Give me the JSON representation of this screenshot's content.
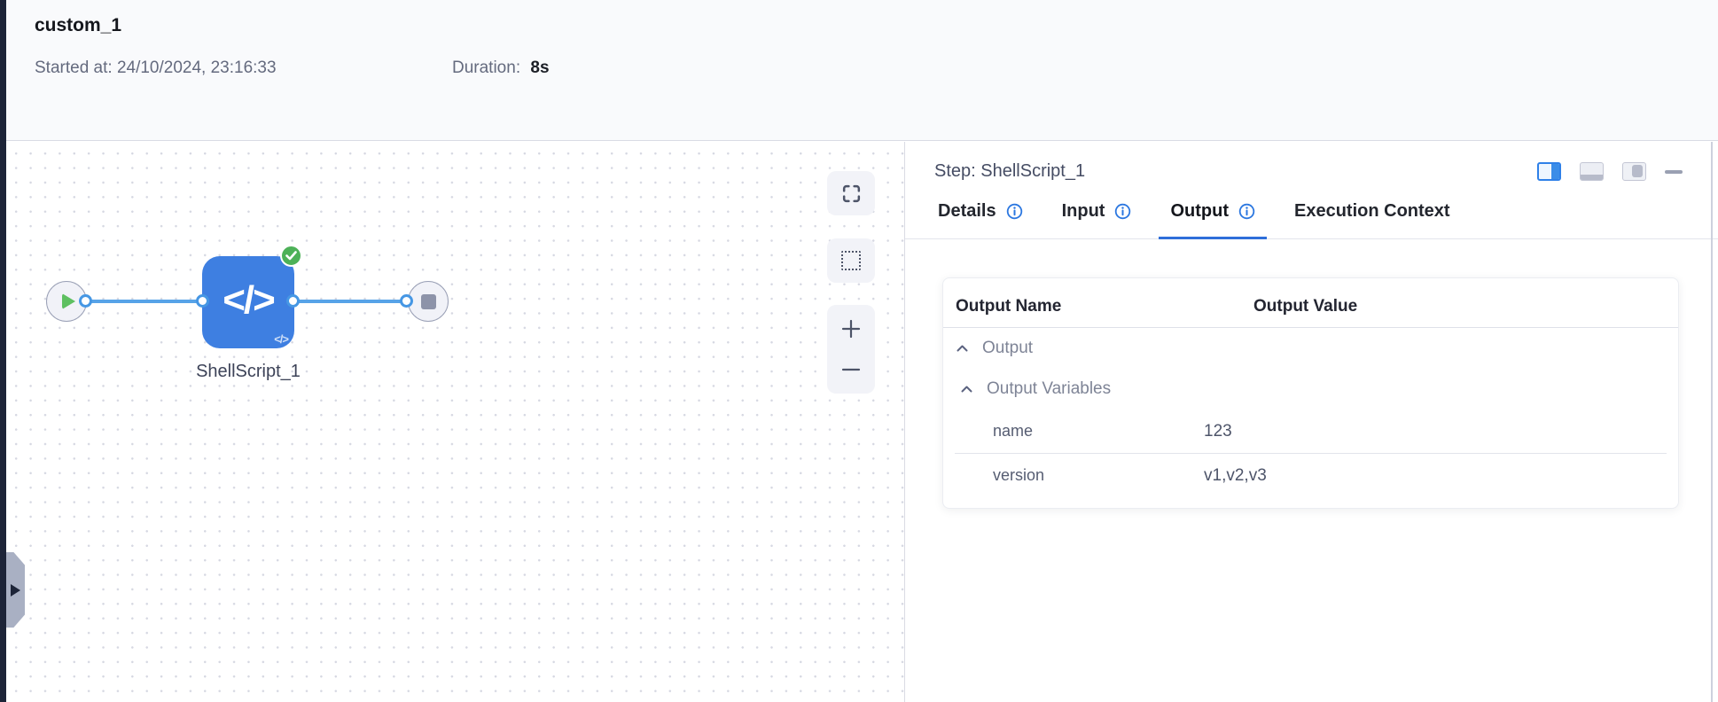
{
  "header": {
    "title": "custom_1",
    "started_label": "Started at:",
    "started_value": "24/10/2024, 23:16:33",
    "duration_label": "Duration:",
    "duration_value": "8s"
  },
  "canvas": {
    "node_label": "ShellScript_1",
    "node_icon": "</>",
    "node_status": "success"
  },
  "panel": {
    "title": "Step: ShellScript_1",
    "tabs": [
      {
        "label": "Details",
        "has_info": true,
        "active": false
      },
      {
        "label": "Input",
        "has_info": true,
        "active": false
      },
      {
        "label": "Output",
        "has_info": true,
        "active": true
      },
      {
        "label": "Execution Context",
        "has_info": false,
        "active": false
      }
    ],
    "table": {
      "columns": [
        "Output Name",
        "Output Value"
      ],
      "groups": [
        {
          "label": "Output",
          "expanded": true
        },
        {
          "label": "Output Variables",
          "expanded": true
        }
      ],
      "rows": [
        {
          "name": "name",
          "value": "123"
        },
        {
          "name": "version",
          "value": "v1,v2,v3"
        }
      ]
    }
  },
  "colors": {
    "accent_blue": "#2e6ed9",
    "node_blue": "#3e7fe1",
    "edge_blue": "#57a3e8",
    "success_green": "#4db158",
    "play_green": "#5ec061",
    "dark_edge": "#1d2438",
    "flap_gray": "#a9b0c3",
    "canvas_dot": "#d6d8e2"
  }
}
